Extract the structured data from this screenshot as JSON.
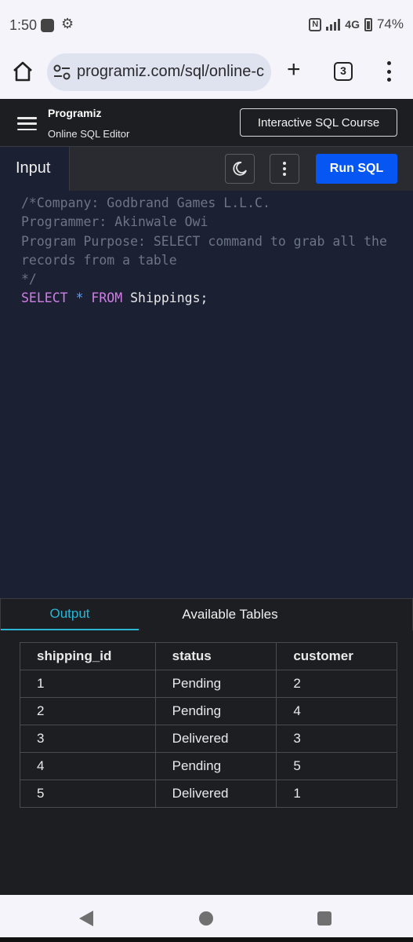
{
  "status_bar": {
    "time": "1:50",
    "network": "4G",
    "battery": "74%",
    "icons": [
      "app-notification-icon",
      "settings-gear-icon",
      "nfc-icon",
      "signal-icon",
      "battery-icon"
    ]
  },
  "browser": {
    "url": "programiz.com/sql/online-c",
    "tab_count": "3",
    "icons": [
      "home-icon",
      "site-settings-icon",
      "new-tab-plus-icon",
      "tabs-icon",
      "more-menu-icon"
    ]
  },
  "site_header": {
    "logo": "Programiz",
    "subtitle": "Online SQL Editor",
    "course_button": "Interactive SQL Course"
  },
  "toolbar": {
    "input_tab": "Input",
    "run_button": "Run SQL",
    "icons": [
      "dark-mode-moon-icon",
      "kebab-menu-icon"
    ]
  },
  "editor": {
    "lines": [
      {
        "comment": "/*Company: Godbrand Games L.L.C."
      },
      {
        "comment": "Programmer: Akinwale Owi"
      },
      {
        "comment": "Program Purpose: SELECT command to grab all the"
      },
      {
        "comment": "records from a table"
      },
      {
        "comment": "*/"
      }
    ],
    "query": {
      "kw1": "SELECT",
      "star": "*",
      "kw2": "FROM",
      "rest": "Shippings;"
    }
  },
  "output_tabs": {
    "output": "Output",
    "tables": "Available Tables"
  },
  "result": {
    "columns": [
      "shipping_id",
      "status",
      "customer"
    ],
    "rows": [
      [
        "1",
        "Pending",
        "2"
      ],
      [
        "2",
        "Pending",
        "4"
      ],
      [
        "3",
        "Delivered",
        "3"
      ],
      [
        "4",
        "Pending",
        "5"
      ],
      [
        "5",
        "Delivered",
        "1"
      ]
    ]
  },
  "colors": {
    "accent_blue": "#0556f3",
    "tab_active": "#2bb5d4",
    "editor_bg": "#1c2033",
    "keyword": "#d07ee6",
    "comment": "#6c7584"
  }
}
